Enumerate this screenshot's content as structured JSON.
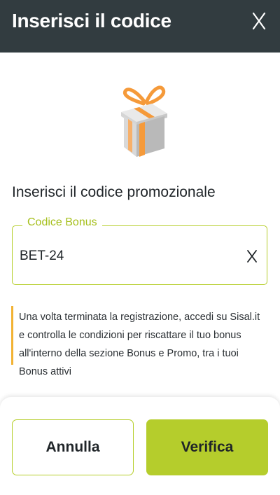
{
  "header": {
    "title": "Inserisci il codice",
    "close_icon": "close-icon"
  },
  "illustration": {
    "icon": "gift-icon"
  },
  "promo": {
    "title": "Inserisci il codice promozionale",
    "field_label": "Codice Bonus",
    "field_value": "BET-24",
    "clear_icon": "close-icon"
  },
  "info": {
    "text": "Una volta terminata la registrazione, accedi su Sisal.it e controlla le condizioni per riscattare il tuo bonus all'interno della sezione Bonus e Promo, tra i tuoi Bonus attivi"
  },
  "footer": {
    "cancel_label": "Annulla",
    "verify_label": "Verifica"
  },
  "colors": {
    "header_bg": "#323c40",
    "accent": "#b5cd2c",
    "info_bar": "#f2b233",
    "gift_orange": "#f59a3a"
  }
}
